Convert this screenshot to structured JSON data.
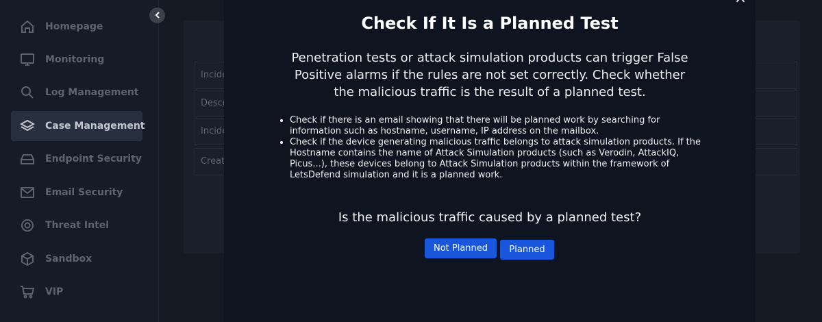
{
  "sidebar": {
    "items": [
      {
        "label": "Homepage",
        "icon": "home-icon",
        "active": false
      },
      {
        "label": "Monitoring",
        "icon": "monitor-icon",
        "active": false
      },
      {
        "label": "Log Management",
        "icon": "search-icon",
        "active": false
      },
      {
        "label": "Case Management",
        "icon": "layers-icon",
        "active": true
      },
      {
        "label": "Endpoint Security",
        "icon": "hard-drive-icon",
        "active": false
      },
      {
        "label": "Email Security",
        "icon": "mail-icon",
        "active": false
      },
      {
        "label": "Threat Intel",
        "icon": "lifebuoy-icon",
        "active": false
      },
      {
        "label": "Sandbox",
        "icon": "box-icon",
        "active": false
      },
      {
        "label": "VIP",
        "icon": "cart-icon",
        "active": false
      }
    ]
  },
  "background_table": {
    "rows": [
      "Incide",
      "Descr",
      "Incide",
      "Creat"
    ]
  },
  "modal": {
    "title": "Check If It Is a Planned Test",
    "intro": "Penetration tests or attack simulation products can trigger False Positive alarms if the rules are not set correctly. Check whether the malicious traffic is the result of a planned test.",
    "bullets": [
      "Check if there is an email showing that there will be planned work by searching for information such as hostname, username, IP address on the mailbox.",
      "Check if the device generating malicious traffic belongs to attack simulation products. If the Hostname contains the name of Attack Simulation products (such as Verodin, AttackIQ, Picus...), these devices belong to Attack Simulation products within the framework of LetsDefend simulation and it is a planned work."
    ],
    "question": "Is the malicious traffic caused by a planned test?",
    "buttons": {
      "not_planned": "Not Planned",
      "planned": "Planned"
    },
    "close_symbol": "×"
  },
  "colors": {
    "accent": "#1a56db",
    "modal_bg": "#0f1520",
    "sidebar_active": "#283040"
  }
}
